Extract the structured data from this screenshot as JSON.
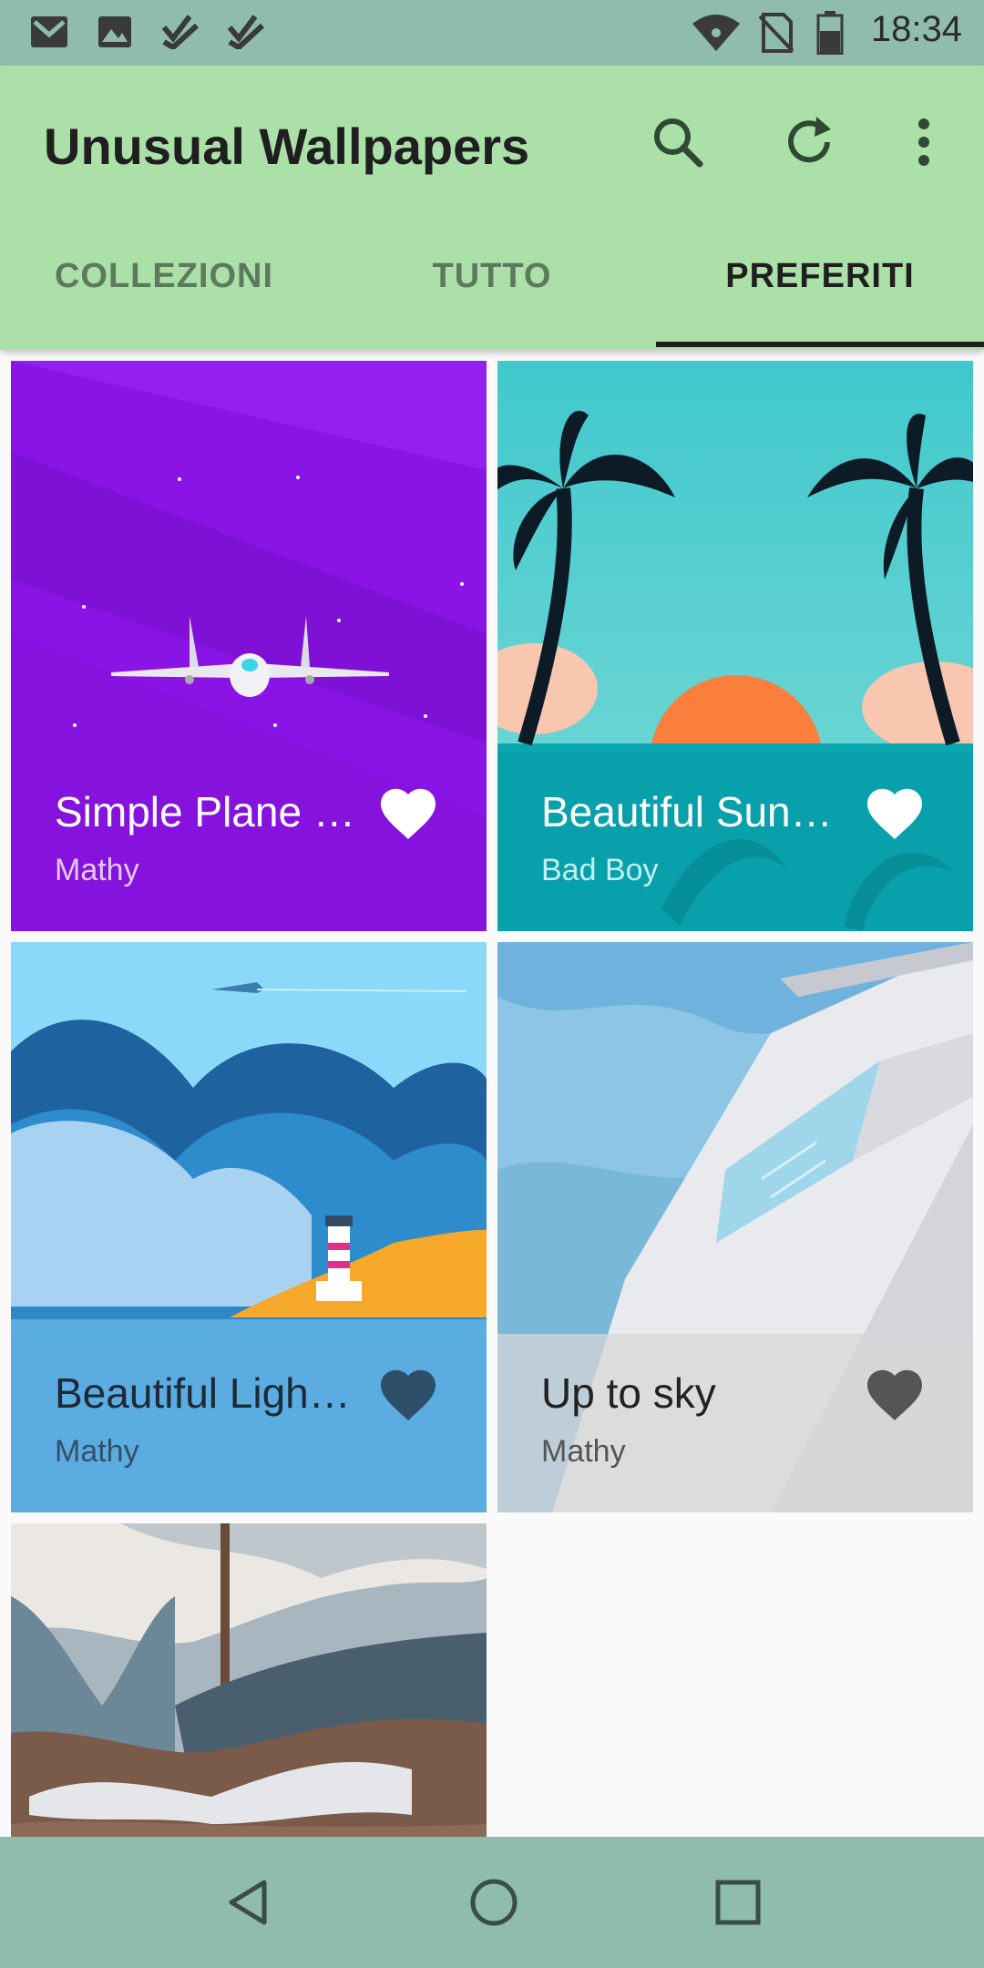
{
  "status_bar": {
    "time": "18:34",
    "left_icons": [
      "gmail-icon",
      "image-icon",
      "task-check-icon",
      "task-check-icon"
    ],
    "right_icons": [
      "wifi-icon",
      "no-sim-icon",
      "battery-icon"
    ]
  },
  "app_bar": {
    "title": "Unusual Wallpapers",
    "actions": [
      "search-icon",
      "refresh-icon",
      "more-vert-icon"
    ]
  },
  "tabs": [
    {
      "label": "COLLEZIONI",
      "active": false
    },
    {
      "label": "TUTTO",
      "active": false
    },
    {
      "label": "PREFERITI",
      "active": true
    }
  ],
  "cards": [
    {
      "title": "Simple Plane …",
      "author": "Mathy",
      "favorite": true
    },
    {
      "title": "Beautiful Sun…",
      "author": "Bad Boy",
      "favorite": true
    },
    {
      "title": "Beautiful Ligh…",
      "author": "Mathy",
      "favorite": true
    },
    {
      "title": "Up to sky",
      "author": "Mathy",
      "favorite": true
    }
  ],
  "nav_bar": [
    "back-icon",
    "home-icon",
    "recents-icon"
  ],
  "colors": {
    "status_bar": "#8fbcad",
    "app_bar": "#abe0a8",
    "active_tab": "#1f1f1f",
    "inactive_tab": "#5d7a5c"
  }
}
